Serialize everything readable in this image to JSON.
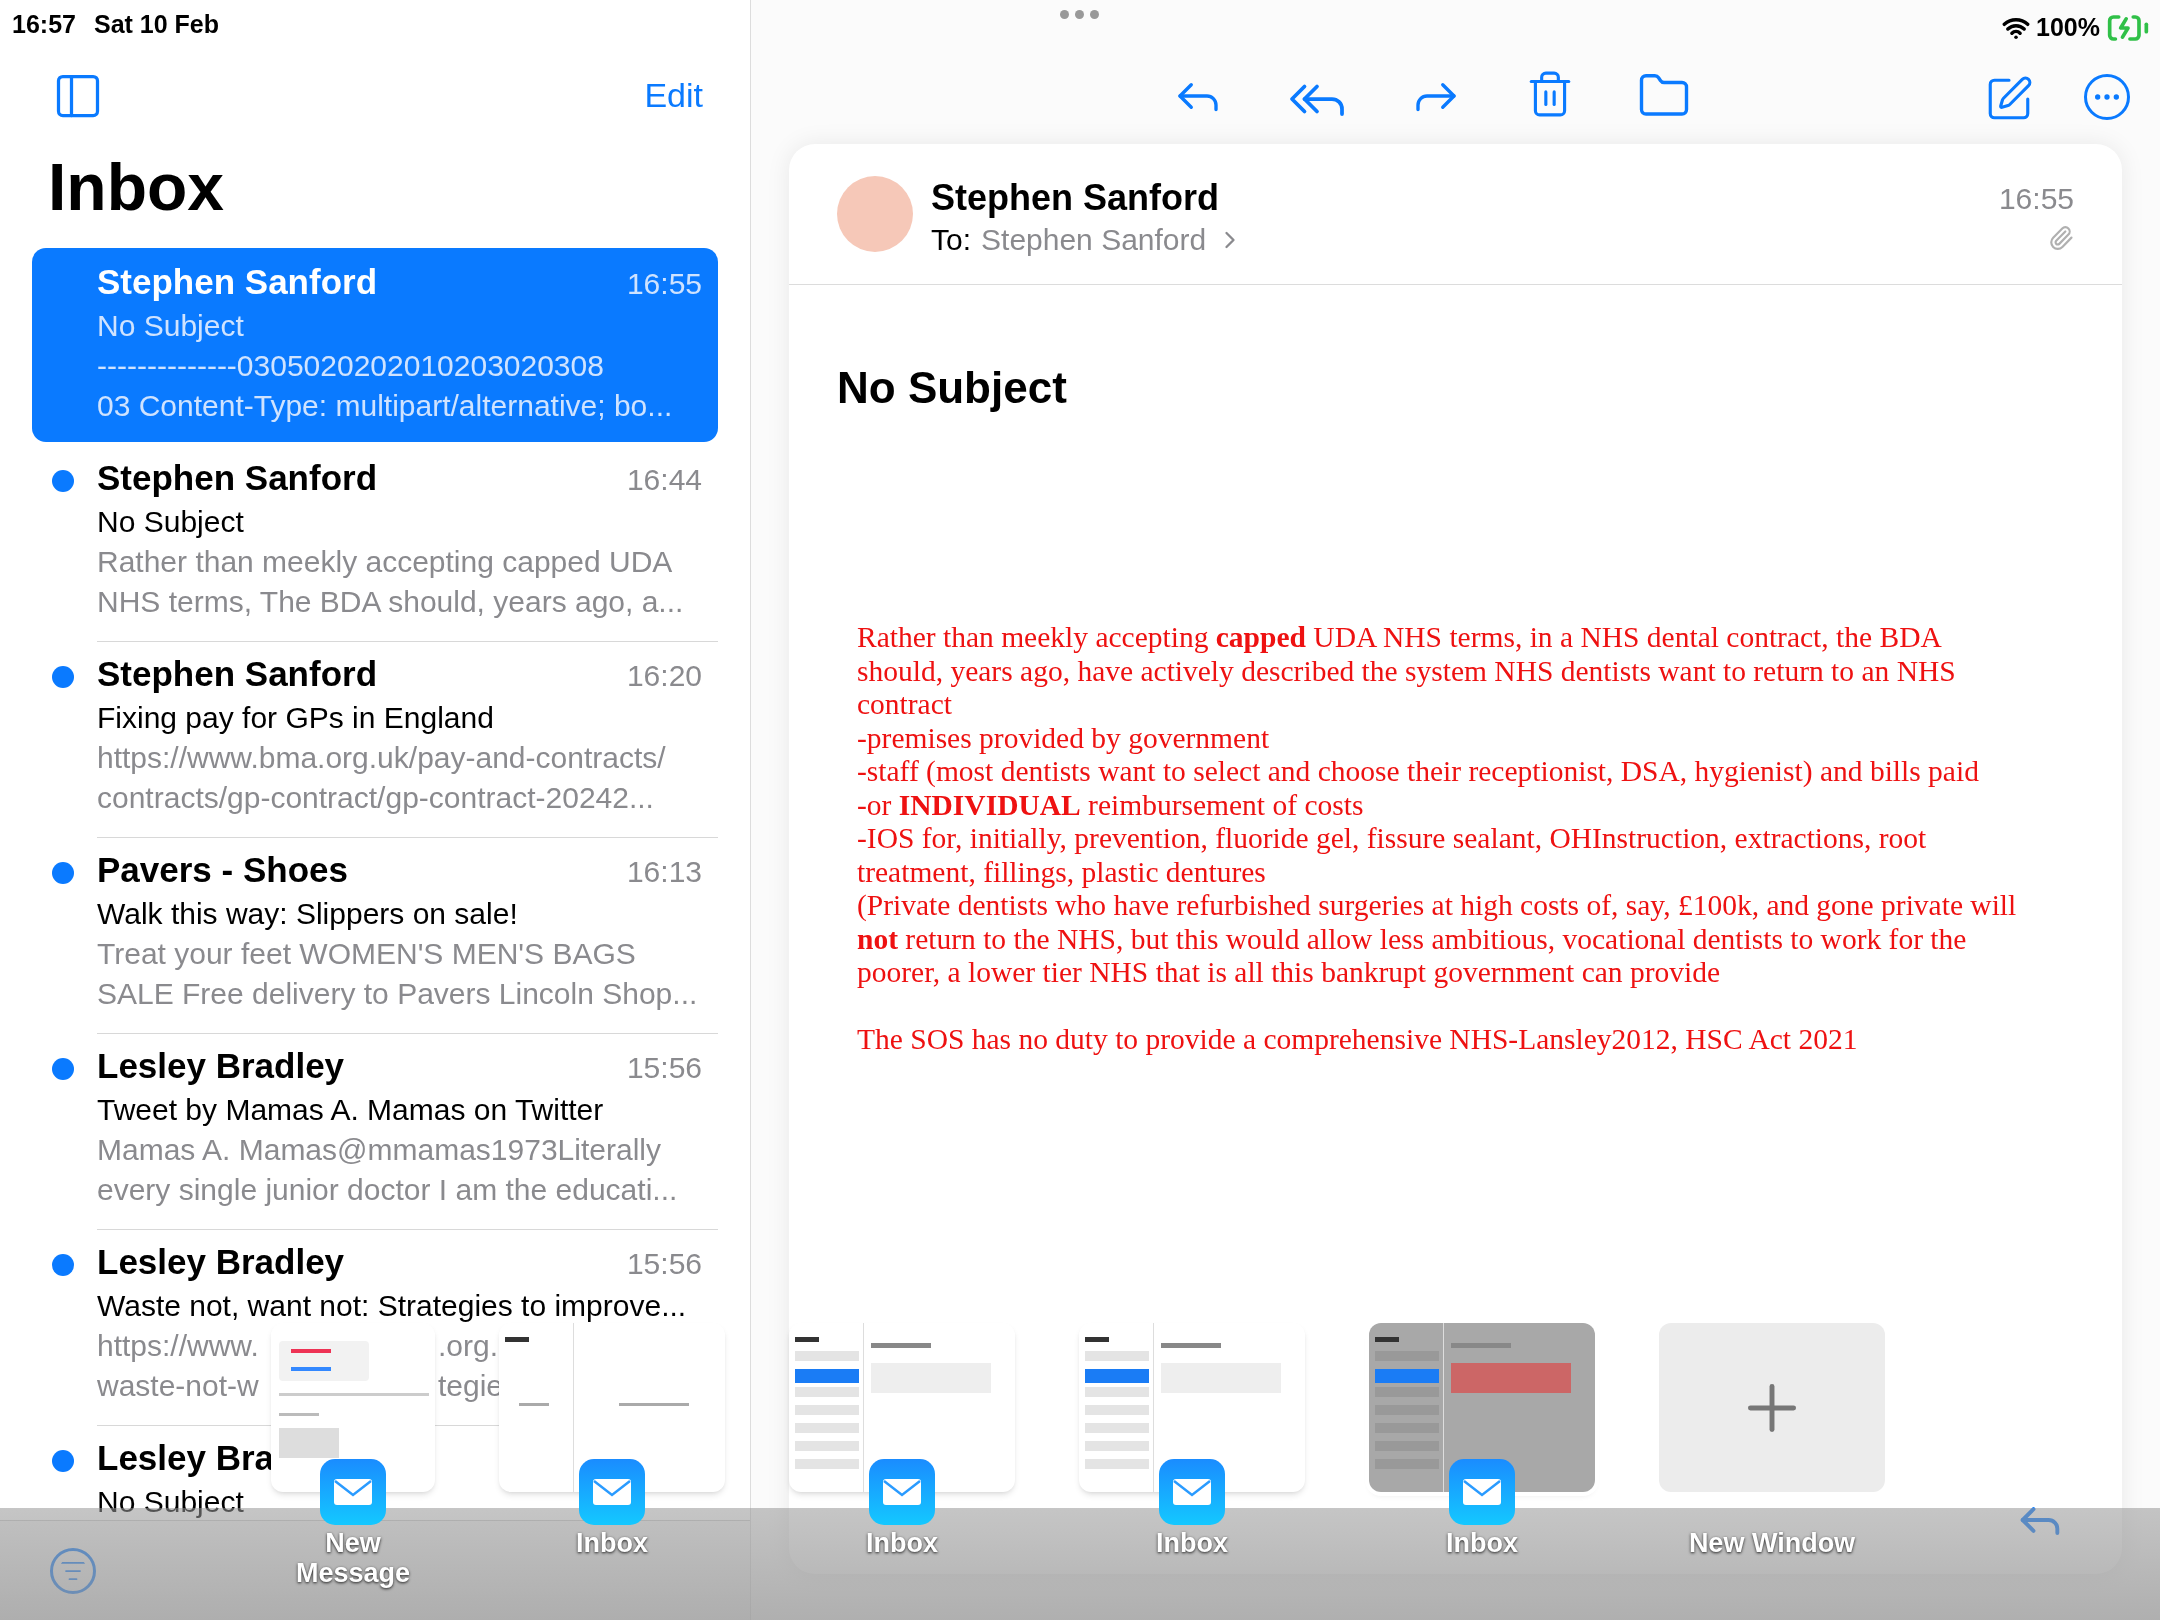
{
  "status_bar": {
    "time": "16:57",
    "date": "Sat 10 Feb",
    "battery": "100%",
    "charging": true
  },
  "list": {
    "edit": "Edit",
    "title": "Inbox",
    "messages": [
      {
        "sender": "Stephen Sanford",
        "time": "16:55",
        "subject": "No Subject",
        "preview_lines": [
          "--------------0305020202010203020308",
          "03 Content-Type: multipart/alternative; bo..."
        ],
        "selected": true,
        "unread": false
      },
      {
        "sender": "Stephen Sanford",
        "time": "16:44",
        "subject": "No Subject",
        "preview_lines": [
          "Rather than meekly accepting capped UDA",
          "NHS terms, The BDA should, years ago, a..."
        ],
        "selected": false,
        "unread": true
      },
      {
        "sender": "Stephen Sanford",
        "time": "16:20",
        "subject": "Fixing pay for GPs in England",
        "preview_lines": [
          "https://www.bma.org.uk/pay-and-contracts/",
          "contracts/gp-contract/gp-contract-20242..."
        ],
        "selected": false,
        "unread": true
      },
      {
        "sender": "Pavers - Shoes",
        "time": "16:13",
        "subject": "Walk this way: Slippers on sale!",
        "preview_lines": [
          "Treat your feet WOMEN'S MEN'S BAGS",
          "SALE Free delivery to Pavers Lincoln Shop..."
        ],
        "selected": false,
        "unread": true
      },
      {
        "sender": "Lesley Bradley",
        "time": "15:56",
        "subject": "Tweet by Mamas A. Mamas on Twitter",
        "preview_lines": [
          "Mamas A. Mamas@mmamas1973Literally",
          "every single junior doctor I am the educati..."
        ],
        "selected": false,
        "unread": true
      },
      {
        "sender": "Lesley Bradley",
        "time": "15:56",
        "subject": "Waste not, want not: Strategies to improve...",
        "preview_fragments": [
          [
            "https://www.",
            ".org."
          ],
          [
            "waste-not-w",
            "tegie"
          ]
        ],
        "selected": false,
        "unread": true
      },
      {
        "sender": "Lesley Bra",
        "subject": "No Subject",
        "selected": false,
        "unread": true
      }
    ]
  },
  "message": {
    "sender": "Stephen Sanford",
    "to_label": "To:",
    "to": "Stephen Sanford",
    "time": "16:55",
    "has_attachment": true,
    "subject": "No Subject",
    "body": [
      "Rather than meekly accepting **capped** UDA NHS terms, in a NHS dental contract,  the BDA should, years ago, have actively described the system NHS dentists want to return to an NHS contract",
      "-premises provided by government",
      "-staff (most dentists want to select and choose their receptionist, DSA, hygienist) and bills paid",
      "-or **INDIVIDUAL** reimbursement of costs",
      "-IOS for, initially, prevention, fluoride gel, fissure sealant, OHInstruction, extractions, root treatment, fillings, plastic dentures",
      "(Private dentists who have refurbished surgeries at high costs of, say, £100k, and gone private will **not** return to the NHS, but this would allow less ambitious, vocational dentists to work for the poorer, a lower tier NHS that is all this bankrupt government can provide",
      {
        "spaced": true,
        "text": "The SOS has no duty to provide a comprehensive NHS-Lansley2012, HSC Act 2021"
      }
    ]
  },
  "shelf": [
    {
      "kind": "compose",
      "label": "New Message",
      "selected": false
    },
    {
      "kind": "empty",
      "label": "Inbox",
      "selected": false
    },
    {
      "kind": "inbox",
      "label": "Inbox",
      "selected": false
    },
    {
      "kind": "inbox",
      "label": "Inbox",
      "selected": false
    },
    {
      "kind": "inbox",
      "label": "Inbox",
      "selected": true
    },
    {
      "kind": "new",
      "label": "New Window",
      "selected": false
    }
  ]
}
